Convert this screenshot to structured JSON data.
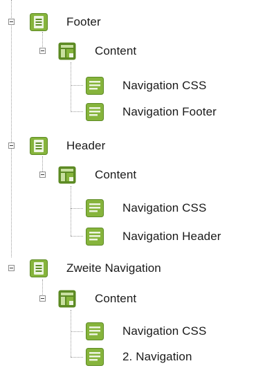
{
  "tree": {
    "pages": [
      {
        "label": "Footer",
        "icon": "page-icon",
        "container": {
          "label": "Content",
          "icon": "content-icon",
          "items": [
            {
              "label": "Navigation CSS",
              "icon": "element-icon"
            },
            {
              "label": "Navigation Footer",
              "icon": "element-icon"
            }
          ]
        }
      },
      {
        "label": "Header",
        "icon": "page-icon",
        "container": {
          "label": "Content",
          "icon": "content-icon",
          "items": [
            {
              "label": "Navigation CSS",
              "icon": "element-icon"
            },
            {
              "label": "Navigation Header",
              "icon": "element-icon"
            }
          ]
        }
      },
      {
        "label": "Zweite Navigation",
        "icon": "page-icon",
        "container": {
          "label": "Content",
          "icon": "content-icon",
          "items": [
            {
              "label": "Navigation CSS",
              "icon": "element-icon"
            },
            {
              "label": "2. Navigation",
              "icon": "element-icon"
            }
          ]
        }
      }
    ]
  },
  "colors": {
    "icon_green_dark": "#5c8a23",
    "icon_green": "#86b43c",
    "icon_green_light": "#c9e0a0",
    "icon_page_fill": "#eef5e2",
    "tree_lines": "#9a9a9a"
  }
}
